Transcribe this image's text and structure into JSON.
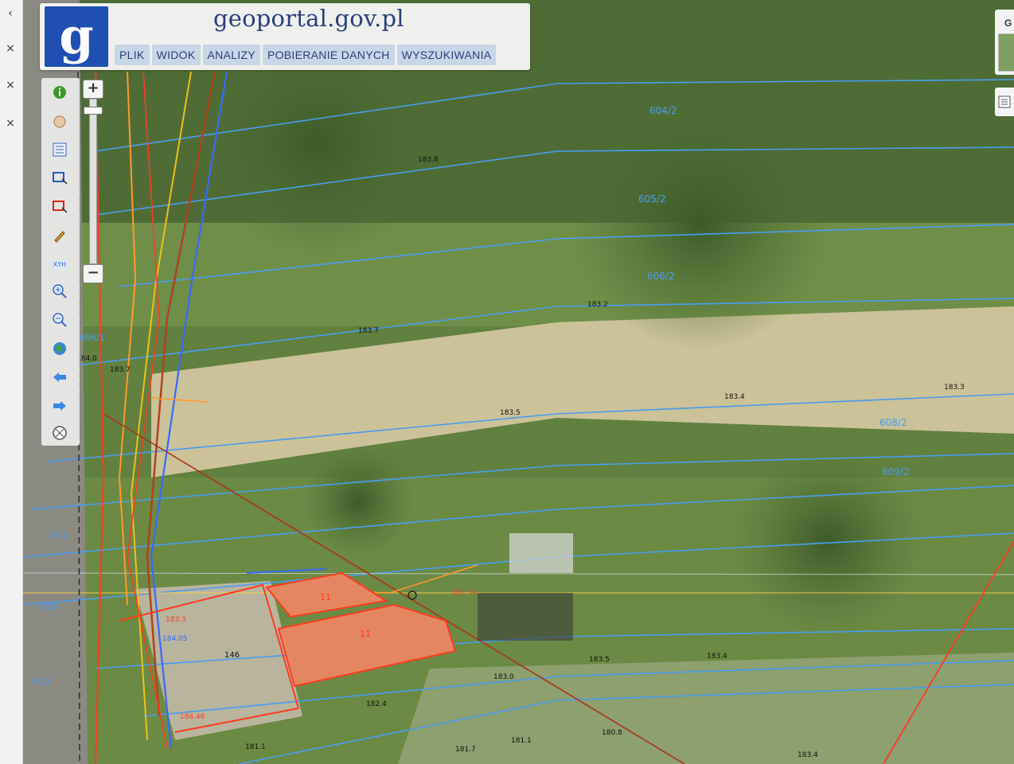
{
  "site": {
    "logo_letter": "g",
    "title": "geoportal.gov.pl"
  },
  "menu": [
    {
      "label": "PLIK"
    },
    {
      "label": "WIDOK"
    },
    {
      "label": "ANALIZY"
    },
    {
      "label": "POBIERANIE DANYCH"
    },
    {
      "label": "WYSZUKIWANIA"
    }
  ],
  "browser_strip": {
    "back_glyph": "‹",
    "close_glyph": "×"
  },
  "zoom": {
    "plus": "+",
    "minus": "−",
    "level_fraction": 0.05
  },
  "toolbar_icons": [
    "info-icon",
    "pan-hand-icon",
    "layers-list-icon",
    "select-area-icon",
    "select-object-icon",
    "pencil-icon",
    "xyh-coordinates-icon",
    "zoom-in-icon",
    "zoom-out-icon",
    "globe-full-extent-icon",
    "history-back-icon",
    "history-forward-icon",
    "clear-icon"
  ],
  "toolbar_labels": {
    "xyh": "XYH"
  },
  "right_controls": {
    "basemap_label": "G"
  },
  "map_labels": {
    "parcels": [
      "604/2",
      "605/2",
      "606/2",
      "608/2",
      "609/2",
      "606/1",
      "609",
      "612",
      "610"
    ],
    "buildings": [
      "11",
      "11",
      "146"
    ],
    "elevations": [
      "183.8",
      "183.7",
      "183.2",
      "183.5",
      "183.4",
      "183.3",
      "183.0",
      "183.4",
      "182.4",
      "183.5",
      "183.4",
      "181.1",
      "181.7",
      "181.1",
      "180.8",
      "184.0",
      "183.7",
      "184.05",
      "184.46",
      "181.54",
      "183.3"
    ],
    "color_legend": {
      "contour_blue": "#4a9cf0",
      "parcel_red": "#ff3b1f",
      "utility_orange": "#ff9a2a",
      "utility_yellow": "#e8c31a",
      "gas_brown": "#b0441a"
    }
  }
}
